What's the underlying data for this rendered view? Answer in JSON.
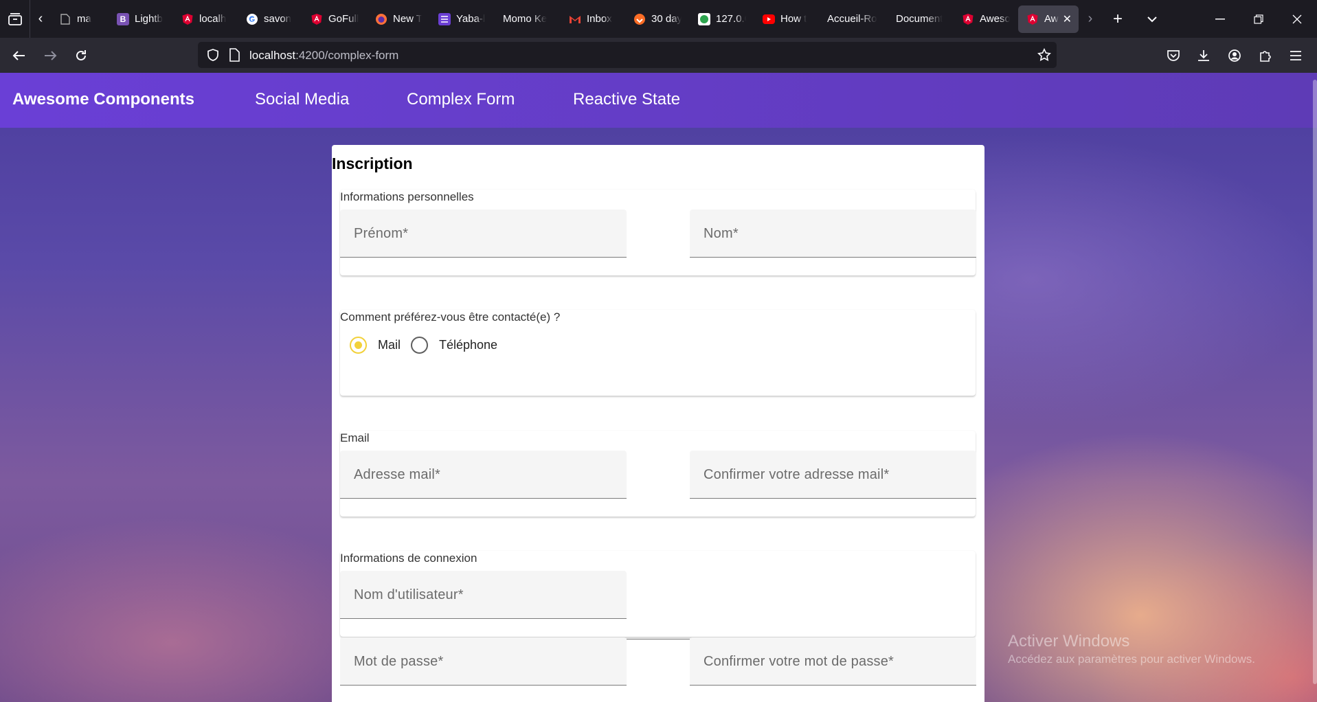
{
  "browser": {
    "tabs": [
      {
        "label": "ma",
        "icon": "generic-page-icon",
        "color": "#1c1b22"
      },
      {
        "label": "Lightb",
        "icon": "bootstrap-icon",
        "color": "#7952b3"
      },
      {
        "label": "localh",
        "icon": "angular-icon",
        "color": "#dd0031"
      },
      {
        "label": "savon",
        "icon": "google-icon",
        "color": "#ffffff"
      },
      {
        "label": "GoFull",
        "icon": "angular-icon",
        "color": "#dd0031"
      },
      {
        "label": "New T",
        "icon": "firefox-icon",
        "color": "#ff7139"
      },
      {
        "label": "Yaba-l",
        "icon": "list-icon",
        "color": "#6b3fd4"
      },
      {
        "label": "Momo Ke",
        "icon": "",
        "color": ""
      },
      {
        "label": "Inbox",
        "icon": "gmail-icon",
        "color": "#ffffff"
      },
      {
        "label": "30 day",
        "icon": "gitlab-icon",
        "color": "#fc6d26"
      },
      {
        "label": "127.0.0",
        "icon": "green-circle-icon",
        "color": "#2da44e"
      },
      {
        "label": "How t",
        "icon": "youtube-icon",
        "color": "#ff0000"
      },
      {
        "label": "Accueil-Ro",
        "icon": "",
        "color": ""
      },
      {
        "label": "Document",
        "icon": "",
        "color": ""
      },
      {
        "label": "Aweso",
        "icon": "angular-icon",
        "color": "#dd0031"
      },
      {
        "label": "Aw",
        "icon": "angular-icon",
        "color": "#dd0031",
        "active": true
      }
    ],
    "url": {
      "host": "localhost",
      "path": ":4200/complex-form"
    }
  },
  "app": {
    "brand": "Awesome Components",
    "nav": [
      "Social Media",
      "Complex Form",
      "Reactive State"
    ],
    "accent": "#6a3fd6"
  },
  "form": {
    "title": "Inscription",
    "personal": {
      "label": "Informations personnelles",
      "first_name": "Prénom*",
      "last_name": "Nom*"
    },
    "contact": {
      "label": "Comment préférez-vous être contacté(e) ?",
      "options": [
        "Mail",
        "Téléphone"
      ],
      "selected": "Mail",
      "radio_color": "#f2d13a"
    },
    "email": {
      "label": "Email",
      "address": "Adresse mail*",
      "confirm": "Confirmer votre adresse mail*"
    },
    "login": {
      "label": "Informations de connexion",
      "username": "Nom d'utilisateur*",
      "password": "Mot de passe*",
      "confirm_password": "Confirmer votre mot de passe*"
    }
  },
  "watermark": {
    "title": "Activer Windows",
    "subtitle": "Accédez aux paramètres pour activer Windows."
  }
}
